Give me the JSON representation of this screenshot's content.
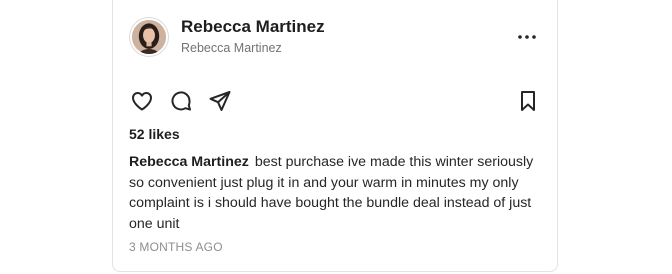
{
  "post": {
    "author": {
      "display_name": "Rebecca Martinez",
      "handle": "Rebecca Martinez",
      "avatar": "profile-photo"
    },
    "actions": {
      "like_icon": "heart-icon",
      "comment_icon": "comment-icon",
      "share_icon": "send-icon",
      "save_icon": "bookmark-icon",
      "more_icon": "more-horizontal-icon"
    },
    "likes": "52 likes",
    "caption": {
      "author": "Rebecca Martinez",
      "text": "best purchase ive made this winter seriously so convenient just plug it in and your warm in minutes my only complaint is i should have bought the bundle deal instead of just one unit"
    },
    "timestamp": "3 MONTHS AGO"
  }
}
